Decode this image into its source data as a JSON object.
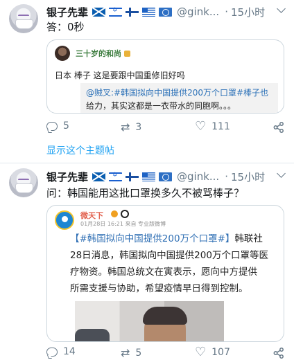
{
  "tweets": [
    {
      "author": "银子先辈",
      "handle": "@gink...",
      "time": "15小时",
      "flags": [
        "scotland-flag-icon",
        "israel-flag-icon",
        "finland-flag-icon",
        "greece-flag-icon",
        "un-flag-icon"
      ],
      "text": "答：0秒",
      "quote": {
        "author": "三十岁的和尚",
        "line1": "日本 棒子 这是要跟中国重修旧好吗",
        "line2": "@贼叉:#韩国拟向中国提供200万个口罩#棒子也",
        "line3": "给力，其实这都是一衣带水的同胞啊。。。"
      },
      "replies": "5",
      "retweets": "3",
      "likes": "111",
      "show_thread": "显示这个主题帖"
    },
    {
      "author": "银子先辈",
      "handle": "@gink...",
      "time": "15小时",
      "flags": [
        "scotland-flag-icon",
        "israel-flag-icon",
        "finland-flag-icon",
        "greece-flag-icon",
        "un-flag-icon"
      ],
      "text": "问：韩国能用这批口罩换多久不被骂棒子？",
      "weibo": {
        "author": "微天下",
        "meta": "01月28日 16:21 来自 专业版微博",
        "line1_topic": "【#韩国拟向中国提供200万个口罩#】",
        "line1_rest": "韩联社",
        "line2": "28日消息，韩国拟向中国提供200万个口罩等医",
        "line3": "疗物资。韩国总统文在寅表示，愿向中方提供",
        "line4": "所需支援与协助，希望疫情早日得到控制。"
      },
      "replies": "14",
      "retweets": "5",
      "likes": "107"
    }
  ],
  "colors": {
    "link": "#1da1f2",
    "muted": "#657786",
    "divider": "#e1e8ed"
  }
}
